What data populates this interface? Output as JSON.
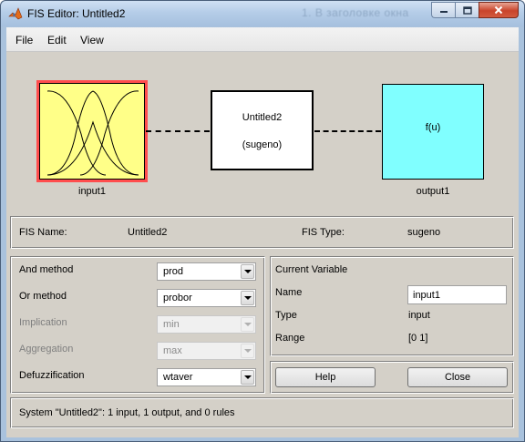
{
  "window": {
    "title": "FIS Editor: Untitled2",
    "ghost_title": "1. В заголовке окна"
  },
  "menu": [
    "File",
    "Edit",
    "View"
  ],
  "diagram": {
    "input_label": "input1",
    "system_name": "Untitled2",
    "system_type": "(sugeno)",
    "output_func": "f(u)",
    "output_label": "output1"
  },
  "info": {
    "fis_name_label": "FIS Name:",
    "fis_name_value": "Untitled2",
    "fis_type_label": "FIS Type:",
    "fis_type_value": "sugeno"
  },
  "methods": {
    "and_label": "And method",
    "and_value": "prod",
    "or_label": "Or method",
    "or_value": "probor",
    "implication_label": "Implication",
    "implication_value": "min",
    "aggregation_label": "Aggregation",
    "aggregation_value": "max",
    "defuzz_label": "Defuzzification",
    "defuzz_value": "wtaver"
  },
  "current_variable": {
    "header": "Current Variable",
    "name_label": "Name",
    "name_value": "input1",
    "type_label": "Type",
    "type_value": "input",
    "range_label": "Range",
    "range_value": "[0 1]"
  },
  "buttons": {
    "help": "Help",
    "close": "Close"
  },
  "status": "System \"Untitled2\": 1 input, 1 output, and 0 rules",
  "colors": {
    "input_fill": "#ffff88",
    "input_highlight": "#ff4d4d",
    "output_fill": "#80ffff",
    "panel_bg": "#d4d0c8"
  }
}
